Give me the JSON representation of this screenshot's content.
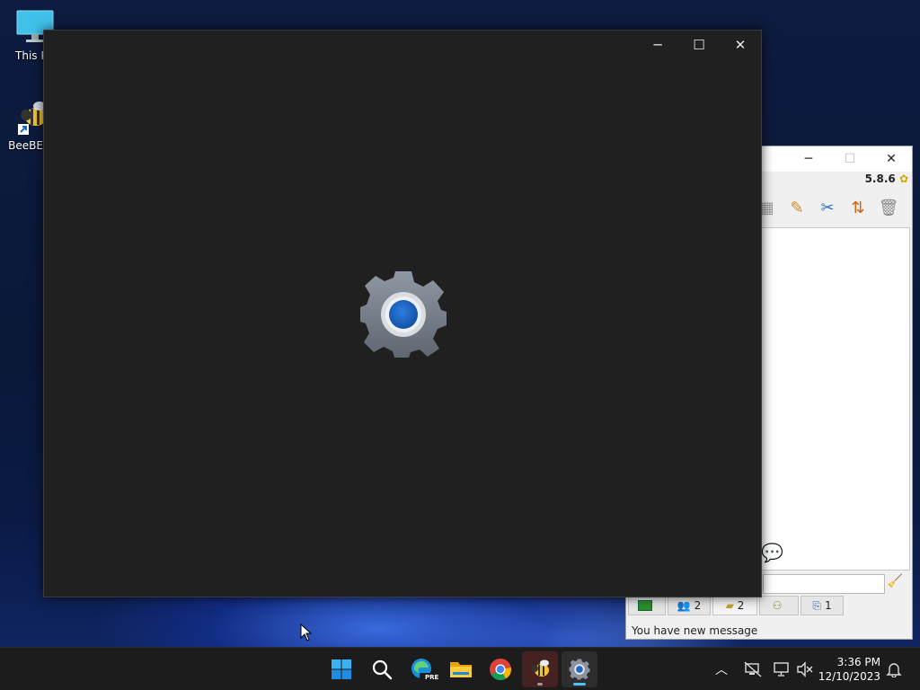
{
  "desktop": {
    "icons": [
      {
        "label": "This PC",
        "icon": "monitor-icon"
      },
      {
        "label": "BeeBEEP",
        "icon": "bee-icon"
      }
    ]
  },
  "beebeep": {
    "title_controls": {
      "minimize": "─",
      "maximize": "☐",
      "close": "✕"
    },
    "version": "5.8.6",
    "tabs": [
      {
        "icon": "chat-icon",
        "count": ""
      },
      {
        "icon": "users-icon",
        "count": "2"
      },
      {
        "icon": "groups-icon",
        "count": "2"
      },
      {
        "icon": "network-icon",
        "count": ""
      },
      {
        "icon": "files-icon",
        "count": "1"
      }
    ],
    "status": "You have new message"
  },
  "settings_window": {
    "controls": {
      "minimize": "─",
      "maximize": "☐",
      "close": "✕"
    },
    "accent_color": "#1e66c8"
  },
  "taskbar": {
    "apps": [
      "start",
      "search",
      "edge-preview",
      "file-explorer",
      "chrome",
      "beebeep",
      "settings"
    ],
    "edge_badge": "PRE",
    "clock": {
      "time": "3:36 PM",
      "date": "12/10/2023"
    }
  }
}
